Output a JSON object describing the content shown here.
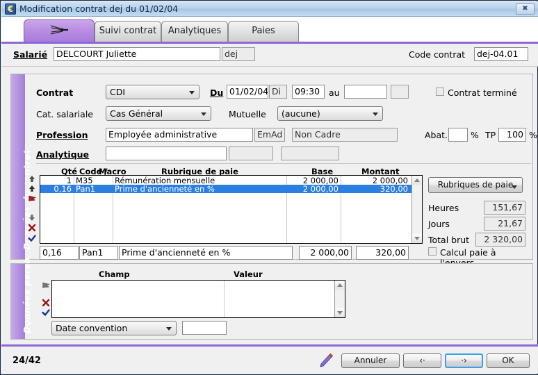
{
  "window": {
    "title": "Modification contrat dej du 01/02/04",
    "app_icon": "euro-icon",
    "close_label": "✖"
  },
  "tabs": [
    {
      "id": "tab-contrat",
      "label": "",
      "icon": "dragonfly-icon",
      "active": true
    },
    {
      "id": "tab-suivi",
      "label": "Suivi contrat",
      "active": false
    },
    {
      "id": "tab-analytiques",
      "label": "Analytiques",
      "active": false
    },
    {
      "id": "tab-paies",
      "label": "Paies",
      "active": false
    }
  ],
  "header": {
    "salarie_label": "Salarié",
    "salarie_value": "DELCOURT Juliette",
    "salarie_code": "dej",
    "code_contrat_label": "Code contrat",
    "code_contrat_value": "dej-04.01"
  },
  "contract_panel": {
    "side_label": "Données du contrat",
    "contrat_label": "Contrat",
    "contrat_value": "CDI",
    "du_label": "Du",
    "du_date": "01/02/04",
    "du_day": "Di",
    "du_time": "09:30",
    "au_label": "au",
    "au_date": "",
    "au_day": "",
    "contrat_termine_label": "Contrat terminé",
    "contrat_termine_checked": false,
    "cat_salariale_label": "Cat. salariale",
    "cat_salariale_value": "Cas Général",
    "mutuelle_label": "Mutuelle",
    "mutuelle_value": "(aucune)",
    "profession_label": "Profession",
    "profession_value": "Employée administrative",
    "profession_code": "EmAd",
    "profession_statut": "Non Cadre",
    "abat_label": "Abat.",
    "abat_value": "",
    "abat_pct": "%",
    "tp_label": "TP",
    "tp_value": "100",
    "tp_pct": "%",
    "analytique_label": "Analytique",
    "analytique_value": "",
    "analytique_code": "",
    "analytique_extra": ""
  },
  "rubriques": {
    "columns": [
      "Qté",
      "Code / Macro",
      "Rubrique de paie",
      "Base",
      "Montant"
    ],
    "col_qte": "Qté",
    "col_code": "Code /",
    "col_macro": "Macro",
    "col_rubrique": "Rubrique de paie",
    "col_base": "Base",
    "col_montant": "Montant",
    "rows": [
      {
        "qte": "1",
        "code": "M35",
        "rubrique": "Rémunération mensuelle",
        "base": "2 000,00",
        "montant": "2 000,00",
        "selected": false
      },
      {
        "qte": "0,16",
        "code": "Pan1",
        "rubrique": "Prime d'ancienneté en %",
        "base": "2 000,00",
        "montant": "320,00",
        "selected": true
      }
    ],
    "edit_row": {
      "qte": "0,16",
      "code": "Pan1",
      "rubrique": "Prime d'ancienneté en %",
      "base": "2 000,00",
      "montant": "320,00"
    },
    "side_icons": [
      "move-up-icon",
      "move-top-icon",
      "red-flag-icon",
      "move-down-icon",
      "delete-red-x-icon",
      "validate-blue-check-icon"
    ]
  },
  "right_panel": {
    "rubriques_button": "Rubriques de paie",
    "heures_label": "Heures",
    "heures_value": "151,67",
    "jours_label": "Jours",
    "jours_value": "21,67",
    "total_brut_label": "Total brut",
    "total_brut_value": "2 320,00",
    "calcul_envers_label": "Calcul paie à l'envers",
    "calcul_envers_checked": false
  },
  "perso_panel": {
    "side_label": "Données perso.",
    "col_champ": "Champ",
    "col_valeur": "Valeur",
    "rows": [],
    "combo_value": "Date convention",
    "value_field": "",
    "side_icons": [
      "red-flag-icon",
      "delete-red-x-icon",
      "validate-blue-check-icon"
    ]
  },
  "footer": {
    "counter": "24/42",
    "pencil_icon": "pencil-icon",
    "cancel_label": "Annuler",
    "prev_label": "‹·",
    "next_label": "·›",
    "ok_label": "OK"
  },
  "colors": {
    "accent_purple": "#8f66d8",
    "selection_blue": "#2a7fe0",
    "titlebar_blue": "#a7c6e5",
    "panel_gray": "#f0f0f0"
  }
}
